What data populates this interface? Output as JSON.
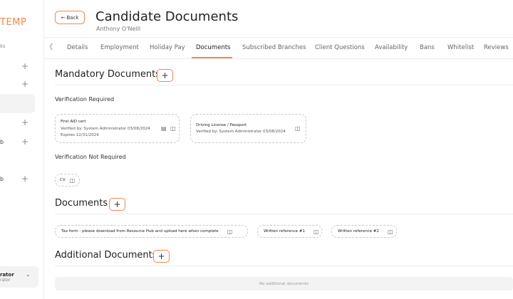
{
  "sidebar": {
    "brand": "TEMP",
    "caption": "ks",
    "rows": [
      {
        "text": "",
        "plus": "+"
      },
      {
        "text": "",
        "plus": "+"
      },
      {
        "text": "",
        "plus": "+"
      },
      {
        "text": "b",
        "plus": "+"
      },
      {
        "text": "b",
        "plus": "+"
      }
    ],
    "user": {
      "name": "rator",
      "role": "rator",
      "chevron": "⌄"
    }
  },
  "header": {
    "back_label": "Back",
    "title": "Candidate Documents",
    "subtitle": "Anthony O'Neill"
  },
  "tabs": {
    "items": [
      {
        "label": "Details"
      },
      {
        "label": "Employment"
      },
      {
        "label": "Holiday Pay"
      },
      {
        "label": "Documents"
      },
      {
        "label": "Subscribed Branches"
      },
      {
        "label": "Client Questions"
      },
      {
        "label": "Availability"
      },
      {
        "label": "Bans"
      },
      {
        "label": "Whitelist"
      },
      {
        "label": "Reviews"
      }
    ],
    "active": "Documents"
  },
  "mandatory": {
    "title": "Mandatory Documents",
    "add_label": "+",
    "verification_required_label": "Verification Required",
    "verified_docs": [
      {
        "title": "First AID cert",
        "verified": "Verified by: System Administrator 03/08/2024",
        "expires": "Expires 12/31/2024"
      },
      {
        "title": "Driving License / Passport",
        "verified": "Verified by: System Administrator 03/08/2024"
      }
    ],
    "verification_not_required_label": "Verification Not Required",
    "unverified_docs": [
      {
        "label": "CV"
      }
    ]
  },
  "documents": {
    "title": "Documents",
    "add_label": "+",
    "items": [
      {
        "label": "Tax form - please download from Resource Hub and upload here when complete"
      },
      {
        "label": "Written reference #1"
      },
      {
        "label": "Written reference #2"
      }
    ]
  },
  "additional": {
    "title": "Additional Documents",
    "add_label": "+",
    "empty_text": "No additional documents"
  },
  "colors": {
    "accent": "#f4874d",
    "divider": "#ececec",
    "muted_bg": "#f3f3f3"
  }
}
